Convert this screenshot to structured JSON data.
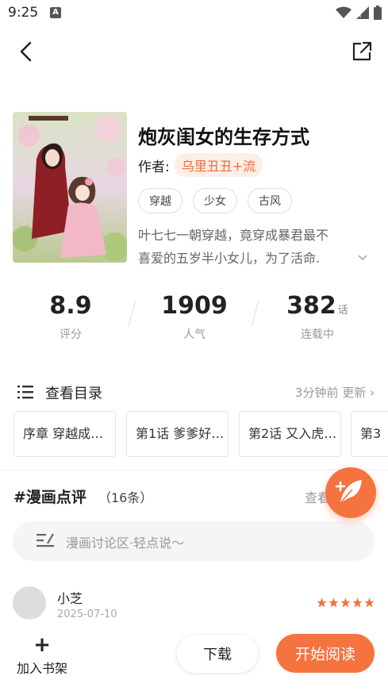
{
  "status_bar": {
    "time": "9:25",
    "notification_icon_letter": "A"
  },
  "book": {
    "title": "炮灰闺女的生存方式",
    "author_label": "作者:",
    "author": "乌里丑丑+流",
    "tags": [
      "穿越",
      "少女",
      "古风"
    ],
    "description_lines": [
      "叶七七一朝穿越，竟穿成暴君最不",
      "喜爱的五岁半小女儿，为了活命."
    ]
  },
  "stats": {
    "rating": {
      "value": "8.9",
      "label": "评分"
    },
    "popularity": {
      "value": "1909",
      "label": "人气"
    },
    "chapters": {
      "value": "382",
      "unit": "话",
      "label": "连载中"
    }
  },
  "catalog": {
    "title": "查看目录",
    "update_text": "3分钟前 更新 ›",
    "chapters": [
      "序章 穿越成…",
      "第1话 爹爹好…",
      "第2话 又入虎…",
      "第3"
    ]
  },
  "reviews": {
    "title": "#漫画点评",
    "count": "（16条）",
    "more": "查看",
    "placeholder": "漫画讨论区·轻点说～",
    "items": [
      {
        "name": "小芝",
        "date": "2025-07-10",
        "stars": 5
      }
    ]
  },
  "bottom_bar": {
    "add_shelf": "加入书架",
    "download": "下载",
    "start_reading": "开始阅读"
  },
  "colors": {
    "accent": "#f5733e",
    "author_chip_bg": "#fdeee6",
    "author_chip_text": "#f36a3a"
  }
}
